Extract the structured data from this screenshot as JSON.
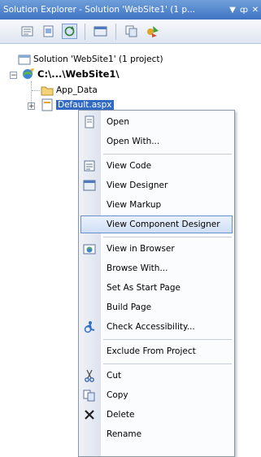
{
  "window": {
    "title": "Solution Explorer - Solution 'WebSite1' (1 p...",
    "pin_glyph": "▼",
    "autohide_glyph": "ȹ",
    "close_glyph": "✕"
  },
  "toolbar": {
    "buttons": [
      "properties-icon",
      "show-all-files-icon",
      "refresh-icon",
      "view-code-icon",
      "copy-website-icon",
      "asp-config-icon"
    ]
  },
  "tree": {
    "solution_label": "Solution 'WebSite1' (1 project)",
    "project_label": "C:\\...\\WebSite1\\",
    "app_data_label": "App_Data",
    "default_label": "Default.aspx"
  },
  "context_menu": {
    "items": [
      {
        "label": "Open",
        "icon": "open-icon"
      },
      {
        "label": "Open With...",
        "icon": ""
      },
      {
        "label": "View Code",
        "icon": "view-code-icon"
      },
      {
        "label": "View Designer",
        "icon": "view-designer-icon"
      },
      {
        "label": "View Markup",
        "icon": ""
      },
      {
        "label": "View Component Designer",
        "icon": "",
        "highlighted": true
      },
      {
        "label": "View in Browser",
        "icon": "view-in-browser-icon"
      },
      {
        "label": "Browse With...",
        "icon": ""
      },
      {
        "label": "Set As Start Page",
        "icon": ""
      },
      {
        "label": "Build Page",
        "icon": ""
      },
      {
        "label": "Check Accessibility...",
        "icon": "accessibility-icon"
      },
      {
        "label": "Exclude From Project",
        "icon": ""
      },
      {
        "label": "Cut",
        "icon": "cut-icon"
      },
      {
        "label": "Copy",
        "icon": "copy-icon"
      },
      {
        "label": "Delete",
        "icon": "delete-icon"
      },
      {
        "label": "Rename",
        "icon": ""
      }
    ]
  }
}
